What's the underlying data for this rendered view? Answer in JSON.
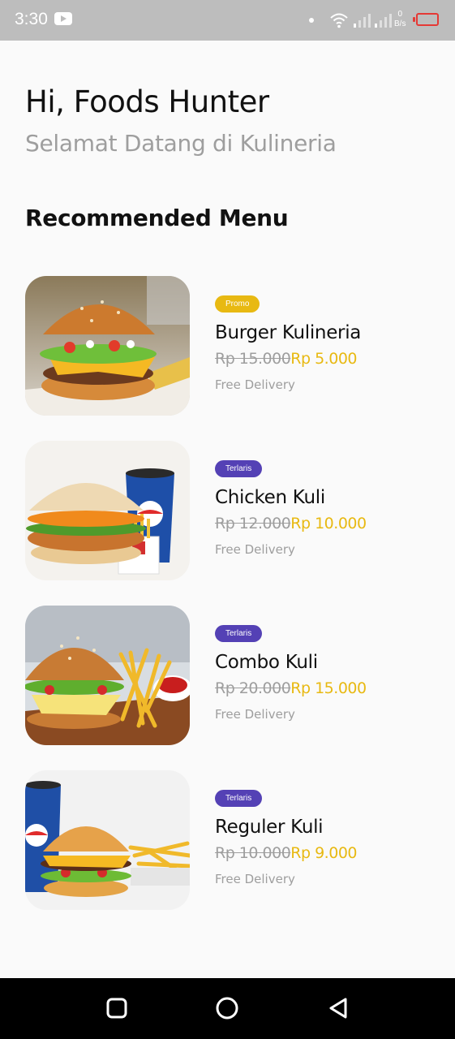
{
  "status_bar": {
    "time": "3:30",
    "net_speed_value": "0",
    "net_speed_unit": "B/s"
  },
  "header": {
    "greeting": "Hi, Foods Hunter",
    "subtitle": "Selamat Datang di Kulineria"
  },
  "section_title": "Recommended Menu",
  "menu": [
    {
      "badge": "Promo",
      "badge_color": "#e8b912",
      "name": "Burger Kulineria",
      "old_price": "Rp 15.000",
      "new_price": "Rp 5.000",
      "delivery": "Free Delivery",
      "image": "burger-image"
    },
    {
      "badge": "Terlaris",
      "badge_color": "#5441b5",
      "name": "Chicken Kuli",
      "old_price": "Rp 12.000",
      "new_price": "Rp 10.000",
      "delivery": "Free Delivery",
      "image": "chicken-burger-combo-image"
    },
    {
      "badge": "Terlaris",
      "badge_color": "#5441b5",
      "name": "Combo Kuli",
      "old_price": "Rp 20.000",
      "new_price": "Rp 15.000",
      "delivery": "Free Delivery",
      "image": "burger-fries-combo-image"
    },
    {
      "badge": "Terlaris",
      "badge_color": "#5441b5",
      "name": "Reguler Kuli",
      "old_price": "Rp 10.000",
      "new_price": "Rp 9.000",
      "delivery": "Free Delivery",
      "image": "burger-drink-fries-image"
    }
  ],
  "colors": {
    "accent": "#e8b912",
    "badge_purple": "#5441b5",
    "muted_text": "#9e9e9e"
  },
  "nav_icons": [
    "recents-icon",
    "home-icon",
    "back-icon"
  ]
}
